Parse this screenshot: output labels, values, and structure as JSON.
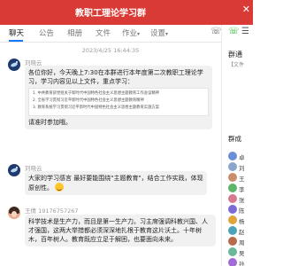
{
  "window": {
    "title": "教职工理论学习群",
    "close_glyph": "✕"
  },
  "tabs": [
    {
      "label": "聊天"
    },
    {
      "label": "公告"
    },
    {
      "label": "相册"
    },
    {
      "label": "文件"
    },
    {
      "label": "作业"
    },
    {
      "label": "设置"
    }
  ],
  "tab_extras": {
    "caret": "▾",
    "right_icon": "☏"
  },
  "chat": {
    "timestamp": "2023/4/25 16:44:35",
    "messages": [
      {
        "sender": "刘晓云",
        "text_intro": "各位你好，今天晚上7:30在本群进行本年度第二次教职工理论学习，学习内容见以上文件，重点学习：",
        "quote": [
          "1. 中共教育部党组关于新时代中国特色社会主义思想主题教育工作会议精神",
          "2. 全省学习贯彻习近平新时代中国特色社会主义思想主题教育精神",
          "3. 教育系统学习贯彻习近平新时代中国特色社会主义思想主题教育实施方案"
        ],
        "text_outro": "请准时参加哦。"
      },
      {
        "sender": "刘晓云",
        "text": "大家的学习感言 最好要能围绕\"主题教育\"，结合工作实践，体现原创性。"
      },
      {
        "sender": "王倩 19176757267",
        "text": "科学技术是生产力，而且是第一生产力。习主席强调科教兴国、人才强国，这两大举措都必须深深地扎根于教育这片沃土。十年树木，百年树人。教育既应立足于解困，也要面向未来。"
      }
    ]
  },
  "sidebar": {
    "title": "群通",
    "note": "【文件",
    "members_label": "群成",
    "icons": {
      "phone": "☏",
      "menu": "☰"
    },
    "members": [
      {
        "name": "卓",
        "color": "#6b8fd6"
      },
      {
        "name": "刘",
        "color": "#8aa7c9"
      },
      {
        "name": "王",
        "color": "#c98f6b"
      },
      {
        "name": "李",
        "color": "#5fb56a"
      },
      {
        "name": "张",
        "color": "#d67a8f"
      },
      {
        "name": "陈",
        "color": "#7a6bd6"
      },
      {
        "name": "杨",
        "color": "#e0a53a"
      },
      {
        "name": "赵",
        "color": "#4aa3b8"
      },
      {
        "name": "周",
        "color": "#b86b4a"
      },
      {
        "name": "吴",
        "color": "#6bb89a"
      },
      {
        "name": "孙",
        "color": "#a36bd6"
      }
    ]
  }
}
